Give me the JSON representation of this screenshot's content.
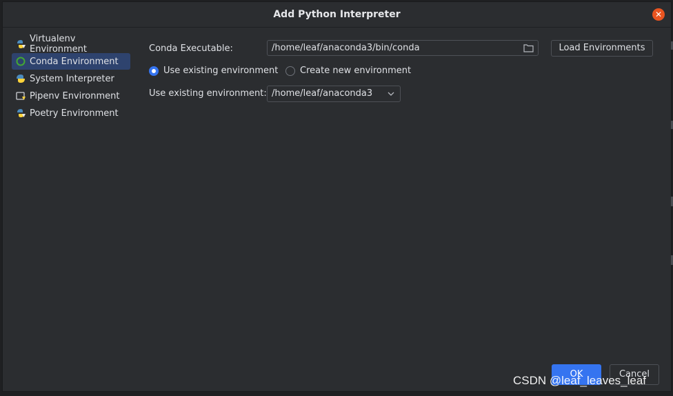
{
  "dialog": {
    "title": "Add Python Interpreter"
  },
  "sidebar": {
    "items": [
      {
        "label": "Virtualenv Environment",
        "icon": "python-virtualenv-icon"
      },
      {
        "label": "Conda Environment",
        "icon": "conda-icon",
        "selected": true
      },
      {
        "label": "System Interpreter",
        "icon": "python-icon"
      },
      {
        "label": "Pipenv Environment",
        "icon": "pipenv-icon"
      },
      {
        "label": "Poetry Environment",
        "icon": "poetry-icon"
      }
    ]
  },
  "conda": {
    "executable_label": "Conda Executable:",
    "executable_value": "/home/leaf/anaconda3/bin/conda",
    "load_button": "Load Environments",
    "radio_existing": "Use existing environment",
    "radio_new": "Create new environment",
    "existing_label": "Use existing environment:",
    "existing_value": "/home/leaf/anaconda3"
  },
  "buttons": {
    "ok": "OK",
    "cancel": "Cancel"
  },
  "watermark": "CSDN @leaf_leaves_leaf",
  "colors": {
    "accent": "#3574f0",
    "selection": "#2e436e",
    "close": "#e95420",
    "background": "#2b2d30"
  }
}
